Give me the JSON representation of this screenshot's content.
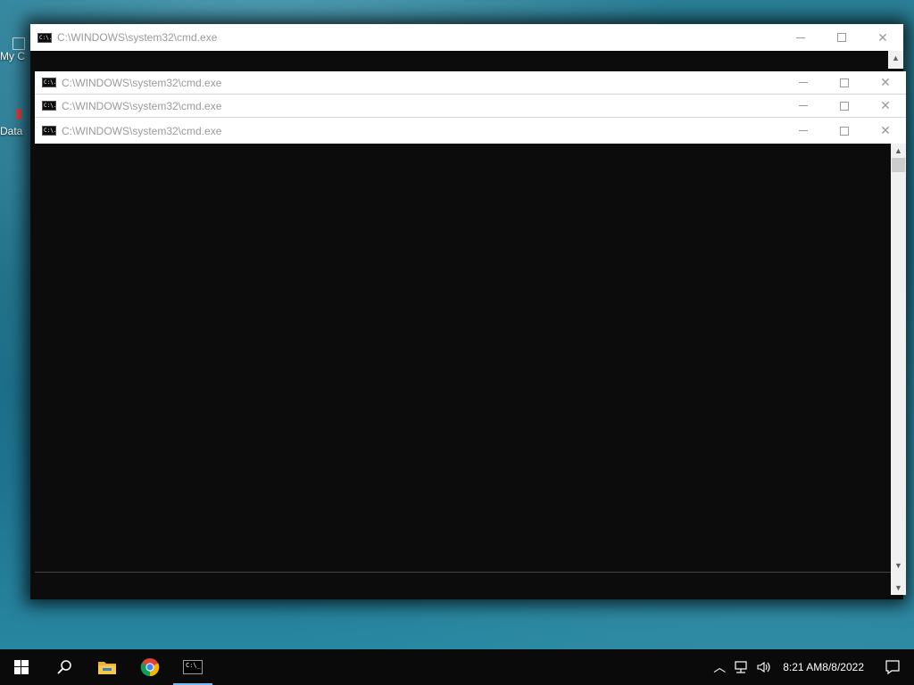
{
  "desktop": {
    "icons": [
      {
        "label": "My C",
        "icon": "computer-icon"
      },
      {
        "label": "Data",
        "icon": "shortcut-icon"
      }
    ]
  },
  "windows": {
    "back": {
      "title": "C:\\WINDOWS\\system32\\cmd.exe",
      "icon_text": "C:\\."
    },
    "stack": [
      {
        "title": "C:\\WINDOWS\\system32\\cmd.exe",
        "icon_text": "C:\\."
      },
      {
        "title": "C:\\WINDOWS\\system32\\cmd.exe",
        "icon_text": "C:\\."
      }
    ],
    "front": {
      "title": "C:\\WINDOWS\\system32\\cmd.exe",
      "icon_text": "C:\\."
    }
  },
  "glyphs": {
    "close": "✕",
    "scroll_up": "▲",
    "scroll_down": "▼",
    "tray_chevron": "︿"
  },
  "taskbar": {
    "buttons": [
      {
        "name": "start-button",
        "icon": "windows-logo-icon"
      },
      {
        "name": "search-button",
        "icon": "search-icon"
      },
      {
        "name": "file-explorer-button",
        "icon": "folder-icon"
      },
      {
        "name": "chrome-button",
        "icon": "chrome-icon"
      },
      {
        "name": "cmd-taskbar-button",
        "icon": "cmd-icon",
        "active": true
      }
    ],
    "clock": {
      "time": "8:21 AM",
      "date": "8/8/2022"
    }
  },
  "colors": {
    "console_bg": "#0c0c0c",
    "titlebar_bg": "#ffffff",
    "title_text": "#9a9a9a",
    "taskbar_bg": "#0a0a0a",
    "active_indicator": "#76b9ed"
  }
}
